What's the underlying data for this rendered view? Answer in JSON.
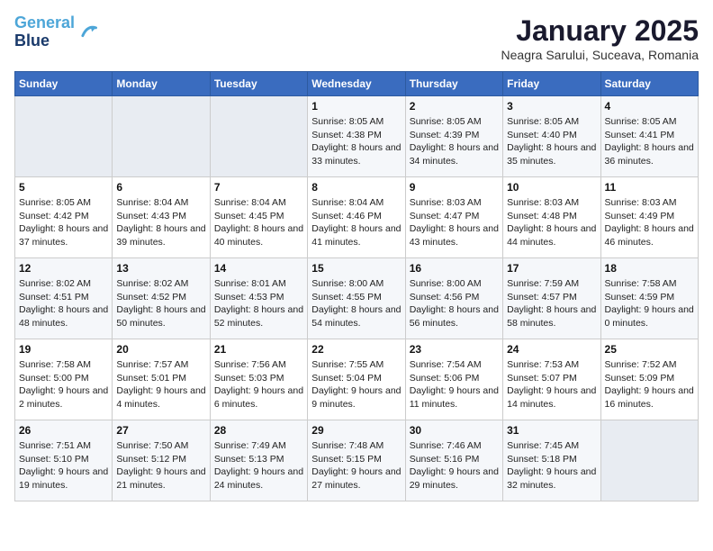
{
  "header": {
    "logo_line1": "General",
    "logo_line2": "Blue",
    "month": "January 2025",
    "location": "Neagra Sarului, Suceava, Romania"
  },
  "weekdays": [
    "Sunday",
    "Monday",
    "Tuesday",
    "Wednesday",
    "Thursday",
    "Friday",
    "Saturday"
  ],
  "weeks": [
    [
      {
        "day": null
      },
      {
        "day": null
      },
      {
        "day": null
      },
      {
        "day": "1",
        "sunrise": "8:05 AM",
        "sunset": "4:38 PM",
        "daylight": "8 hours and 33 minutes."
      },
      {
        "day": "2",
        "sunrise": "8:05 AM",
        "sunset": "4:39 PM",
        "daylight": "8 hours and 34 minutes."
      },
      {
        "day": "3",
        "sunrise": "8:05 AM",
        "sunset": "4:40 PM",
        "daylight": "8 hours and 35 minutes."
      },
      {
        "day": "4",
        "sunrise": "8:05 AM",
        "sunset": "4:41 PM",
        "daylight": "8 hours and 36 minutes."
      }
    ],
    [
      {
        "day": "5",
        "sunrise": "8:05 AM",
        "sunset": "4:42 PM",
        "daylight": "8 hours and 37 minutes."
      },
      {
        "day": "6",
        "sunrise": "8:04 AM",
        "sunset": "4:43 PM",
        "daylight": "8 hours and 39 minutes."
      },
      {
        "day": "7",
        "sunrise": "8:04 AM",
        "sunset": "4:45 PM",
        "daylight": "8 hours and 40 minutes."
      },
      {
        "day": "8",
        "sunrise": "8:04 AM",
        "sunset": "4:46 PM",
        "daylight": "8 hours and 41 minutes."
      },
      {
        "day": "9",
        "sunrise": "8:03 AM",
        "sunset": "4:47 PM",
        "daylight": "8 hours and 43 minutes."
      },
      {
        "day": "10",
        "sunrise": "8:03 AM",
        "sunset": "4:48 PM",
        "daylight": "8 hours and 44 minutes."
      },
      {
        "day": "11",
        "sunrise": "8:03 AM",
        "sunset": "4:49 PM",
        "daylight": "8 hours and 46 minutes."
      }
    ],
    [
      {
        "day": "12",
        "sunrise": "8:02 AM",
        "sunset": "4:51 PM",
        "daylight": "8 hours and 48 minutes."
      },
      {
        "day": "13",
        "sunrise": "8:02 AM",
        "sunset": "4:52 PM",
        "daylight": "8 hours and 50 minutes."
      },
      {
        "day": "14",
        "sunrise": "8:01 AM",
        "sunset": "4:53 PM",
        "daylight": "8 hours and 52 minutes."
      },
      {
        "day": "15",
        "sunrise": "8:00 AM",
        "sunset": "4:55 PM",
        "daylight": "8 hours and 54 minutes."
      },
      {
        "day": "16",
        "sunrise": "8:00 AM",
        "sunset": "4:56 PM",
        "daylight": "8 hours and 56 minutes."
      },
      {
        "day": "17",
        "sunrise": "7:59 AM",
        "sunset": "4:57 PM",
        "daylight": "8 hours and 58 minutes."
      },
      {
        "day": "18",
        "sunrise": "7:58 AM",
        "sunset": "4:59 PM",
        "daylight": "9 hours and 0 minutes."
      }
    ],
    [
      {
        "day": "19",
        "sunrise": "7:58 AM",
        "sunset": "5:00 PM",
        "daylight": "9 hours and 2 minutes."
      },
      {
        "day": "20",
        "sunrise": "7:57 AM",
        "sunset": "5:01 PM",
        "daylight": "9 hours and 4 minutes."
      },
      {
        "day": "21",
        "sunrise": "7:56 AM",
        "sunset": "5:03 PM",
        "daylight": "9 hours and 6 minutes."
      },
      {
        "day": "22",
        "sunrise": "7:55 AM",
        "sunset": "5:04 PM",
        "daylight": "9 hours and 9 minutes."
      },
      {
        "day": "23",
        "sunrise": "7:54 AM",
        "sunset": "5:06 PM",
        "daylight": "9 hours and 11 minutes."
      },
      {
        "day": "24",
        "sunrise": "7:53 AM",
        "sunset": "5:07 PM",
        "daylight": "9 hours and 14 minutes."
      },
      {
        "day": "25",
        "sunrise": "7:52 AM",
        "sunset": "5:09 PM",
        "daylight": "9 hours and 16 minutes."
      }
    ],
    [
      {
        "day": "26",
        "sunrise": "7:51 AM",
        "sunset": "5:10 PM",
        "daylight": "9 hours and 19 minutes."
      },
      {
        "day": "27",
        "sunrise": "7:50 AM",
        "sunset": "5:12 PM",
        "daylight": "9 hours and 21 minutes."
      },
      {
        "day": "28",
        "sunrise": "7:49 AM",
        "sunset": "5:13 PM",
        "daylight": "9 hours and 24 minutes."
      },
      {
        "day": "29",
        "sunrise": "7:48 AM",
        "sunset": "5:15 PM",
        "daylight": "9 hours and 27 minutes."
      },
      {
        "day": "30",
        "sunrise": "7:46 AM",
        "sunset": "5:16 PM",
        "daylight": "9 hours and 29 minutes."
      },
      {
        "day": "31",
        "sunrise": "7:45 AM",
        "sunset": "5:18 PM",
        "daylight": "9 hours and 32 minutes."
      },
      {
        "day": null
      }
    ]
  ],
  "labels": {
    "sunrise": "Sunrise:",
    "sunset": "Sunset:",
    "daylight": "Daylight hours"
  }
}
